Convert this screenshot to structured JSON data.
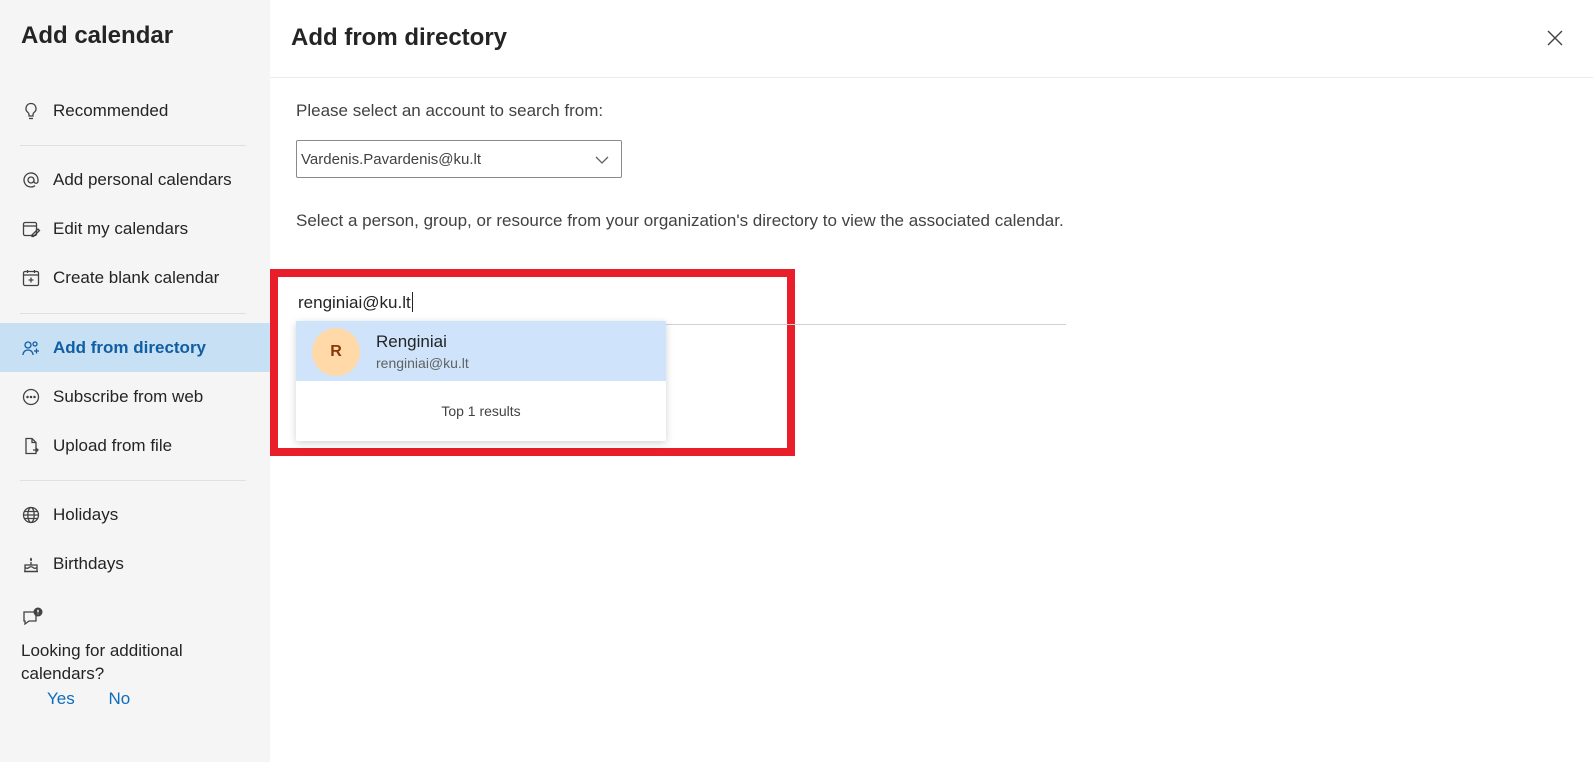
{
  "sidebar": {
    "title": "Add calendar",
    "items": [
      {
        "label": "Recommended",
        "icon": "lightbulb-icon"
      },
      {
        "label": "Add personal calendars",
        "icon": "at-icon"
      },
      {
        "label": "Edit my calendars",
        "icon": "edit-icon"
      },
      {
        "label": "Create blank calendar",
        "icon": "calendar-add-icon"
      },
      {
        "label": "Add from directory",
        "icon": "people-search-icon",
        "active": true
      },
      {
        "label": "Subscribe from web",
        "icon": "link-circle-icon"
      },
      {
        "label": "Upload from file",
        "icon": "document-arrow-icon"
      },
      {
        "label": "Holidays",
        "icon": "globe-icon"
      },
      {
        "label": "Birthdays",
        "icon": "cake-icon"
      }
    ],
    "feedback": {
      "question": "Looking for additional calendars?",
      "yes": "Yes",
      "no": "No"
    }
  },
  "main": {
    "title": "Add from directory",
    "account_prompt": "Please select an account to search from:",
    "account_selected": "Vardenis.Pavardenis@ku.lt",
    "directory_prompt": "Select a person, group, or resource from your organization's directory to view the associated calendar.",
    "search_value": "renginiai@ku.lt",
    "suggestions": [
      {
        "initial": "R",
        "name": "Renginiai",
        "email": "renginiai@ku.lt"
      }
    ],
    "results_count": "Top 1 results"
  },
  "colors": {
    "accent": "#0f6cbd",
    "active_bg": "#c7e0f4",
    "highlight": "#e81e2b",
    "avatar_bg": "#ffd9a8"
  }
}
